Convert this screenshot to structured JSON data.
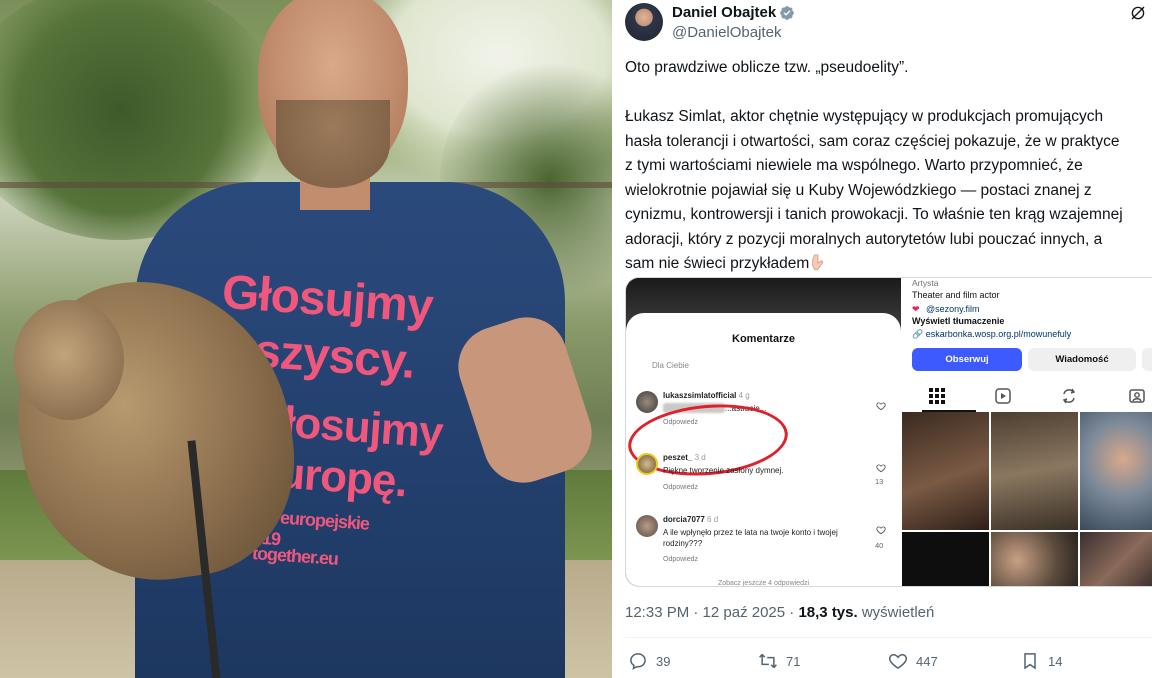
{
  "photo": {
    "shirt_line1": "Głosujmy",
    "shirt_line2": "wszyscy.",
    "shirt_line3": "Głosujmy",
    "shirt_line4": "Europę.",
    "shirt_line5": "ty europejskie",
    "shirt_line6": "2019",
    "shirt_line7": "together.eu",
    "colors": {
      "shirt": "#223f6d",
      "print": "#f0577d"
    }
  },
  "tweet": {
    "author_name": "Daniel Obajtek",
    "handle": "@DanielObajtek",
    "paragraph1": "Oto prawdziwe oblicze tzw. „pseudoelity”.",
    "paragraph2": "Łukasz Simlat, aktor chętnie występujący w produkcjach promujących\nhasła tolerancji i otwartości, sam coraz częściej pokazuje, że w praktyce\nz tymi wartościami niewiele ma wspólnego. Warto przypomnieć, że\nwielokrotnie pojawiał się u Kuby Wojewódzkiego — postaci znanej z\ncynizmu, kontrowersji i tanich prowokacji. To właśnie ten krąg wzajemnej\nadoracji, który z pozycji moralnych autorytetów lubi pouczać innych, a\nsam nie świeci przykładem",
    "trailing_emoji": "pointing-down-hand-icon",
    "timestamp": "12:33 PM · 12 paź 2025 ·",
    "views_count": "18,3 tys.",
    "views_label": "wyświetleń",
    "actions": {
      "replies": "39",
      "reposts": "71",
      "likes": "447",
      "bookmarks": "14"
    },
    "colors": {
      "verified": "#829aab",
      "text": "#0f1419",
      "muted": "#536471"
    }
  },
  "instagram_comments": {
    "title": "Komentarze",
    "filter": "Dla Ciebie",
    "comments": [
      {
        "user": "lukaszsimlatofficial",
        "time": "4 g",
        "text": "...astracie...",
        "reply": "Odpowiedz",
        "likes": ""
      },
      {
        "user": "peszet_",
        "time": "3 d",
        "text": "Piękne tworzenie zasłony dymnej.",
        "reply": "Odpowiedz",
        "likes": "13"
      },
      {
        "user": "dorcia7077",
        "time": "6 d",
        "text": "A ile wpłynęło przez te lata na twoje konto i twojej rodziny???",
        "reply": "Odpowiedz",
        "likes": "40"
      }
    ],
    "more": "Zobacz jeszcze 4 odpowiedzi"
  },
  "instagram_profile": {
    "category": "Artysta",
    "bio": "Theater and film actor",
    "link1": "@sezony.film",
    "translate": "Wyświetl tłumaczenie",
    "link2": "eskarbonka.wosp.org.pl/mowunefuly",
    "follow": "Obserwuj",
    "message": "Wiadomość",
    "more": "+"
  }
}
